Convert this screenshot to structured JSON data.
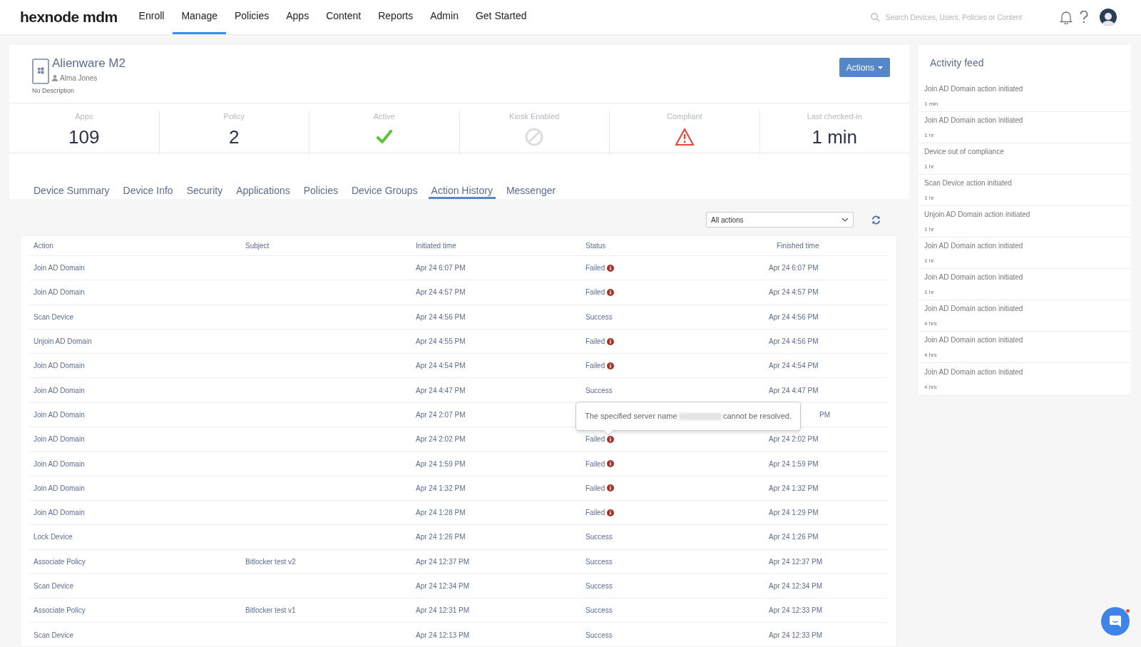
{
  "header": {
    "logo": "hexnode mdm",
    "nav": [
      {
        "label": "Enroll",
        "selected": false
      },
      {
        "label": "Manage",
        "selected": true
      },
      {
        "label": "Policies",
        "selected": false
      },
      {
        "label": "Apps",
        "selected": false
      },
      {
        "label": "Content",
        "selected": false
      },
      {
        "label": "Reports",
        "selected": false
      },
      {
        "label": "Admin",
        "selected": false
      },
      {
        "label": "Get Started",
        "selected": false
      }
    ],
    "search": {
      "placeholder": "Search Devices, Users, Policies or Content"
    }
  },
  "device": {
    "name": "Alienware M2",
    "user": "Alma Jones",
    "description": "No Description",
    "actions_button": "Actions"
  },
  "stats": [
    {
      "label": "Apps",
      "kind": "text",
      "value": "109"
    },
    {
      "label": "Policy",
      "kind": "text",
      "value": "2"
    },
    {
      "label": "Active",
      "kind": "check"
    },
    {
      "label": "Kiosk Enabled",
      "kind": "disabled"
    },
    {
      "label": "Compliant",
      "kind": "warning"
    },
    {
      "label": "Last checked-in",
      "kind": "text",
      "value": "1 min"
    }
  ],
  "tabs": [
    {
      "label": "Device Summary",
      "selected": false
    },
    {
      "label": "Device Info",
      "selected": false
    },
    {
      "label": "Security",
      "selected": false
    },
    {
      "label": "Applications",
      "selected": false
    },
    {
      "label": "Policies",
      "selected": false
    },
    {
      "label": "Device Groups",
      "selected": false
    },
    {
      "label": "Action History",
      "selected": true
    },
    {
      "label": "Messenger",
      "selected": false
    }
  ],
  "filter": {
    "value": "All actions"
  },
  "table": {
    "columns": [
      "Action",
      "Subject",
      "Initiated time",
      "Status",
      "Finished time"
    ],
    "rows": [
      {
        "action": "Join AD Domain",
        "initiated": "Apr 24 6:07 PM",
        "status": "Failed",
        "kind": "failed",
        "finished": "Apr 24 6:07 PM"
      },
      {
        "action": "Join AD Domain",
        "initiated": "Apr 24 4:57 PM",
        "status": "Failed",
        "kind": "failed",
        "finished": "Apr 24 4:57 PM"
      },
      {
        "action": "Scan Device",
        "initiated": "Apr 24 4:56 PM",
        "status": "Success",
        "kind": "success",
        "finished": "Apr 24 4:56 PM"
      },
      {
        "action": "Unjoin AD Domain",
        "initiated": "Apr 24 4:55 PM",
        "status": "Failed",
        "kind": "failed",
        "finished": "Apr 24 4:56 PM"
      },
      {
        "action": "Join AD Domain",
        "initiated": "Apr 24 4:54 PM",
        "status": "Failed",
        "kind": "failed",
        "finished": "Apr 24 4:54 PM"
      },
      {
        "action": "Join AD Domain",
        "initiated": "Apr 24 4:47 PM",
        "status": "Success",
        "kind": "success",
        "finished": "Apr 24 4:47 PM"
      },
      {
        "action": "Join AD Domain",
        "initiated": "Apr 24 2:07 PM",
        "finished": "PM"
      },
      {
        "action": "Join AD Domain",
        "initiated": "Apr 24 2:02 PM",
        "status": "Failed",
        "kind": "failed",
        "finished": "Apr 24 2:02 PM",
        "tooltip": {
          "before": "The specified server name",
          "after": "cannot be resolved."
        }
      },
      {
        "action": "Join AD Domain",
        "initiated": "Apr 24 1:59 PM",
        "status": "Failed",
        "kind": "failed",
        "finished": "Apr 24 1:59 PM"
      },
      {
        "action": "Join AD Domain",
        "initiated": "Apr 24 1:32 PM",
        "status": "Failed",
        "kind": "failed",
        "finished": "Apr 24 1:32 PM"
      },
      {
        "action": "Join AD Domain",
        "initiated": "Apr 24 1:28 PM",
        "status": "Failed",
        "kind": "failed",
        "finished": "Apr 24 1:29 PM"
      },
      {
        "action": "Lock Device",
        "initiated": "Apr 24 1:26 PM",
        "status": "Success",
        "kind": "success",
        "finished": "Apr 24 1:26 PM"
      },
      {
        "action": "Associate Policy",
        "subject": "Bitlocker test v2",
        "initiated": "Apr 24 12:37 PM",
        "status": "Success",
        "kind": "success",
        "finished": "Apr 24 12:37 PM"
      },
      {
        "action": "Scan Device",
        "initiated": "Apr 24 12:34 PM",
        "status": "Success",
        "kind": "success",
        "finished": "Apr 24 12:34 PM"
      },
      {
        "action": "Associate Policy",
        "subject": "Bitlocker test v1",
        "initiated": "Apr 24 12:31 PM",
        "status": "Success",
        "kind": "success",
        "finished": "Apr 24 12:33 PM"
      },
      {
        "action": "Scan Device",
        "initiated": "Apr 24 12:13 PM",
        "status": "Success",
        "kind": "success",
        "finished": "Apr 24 12:33 PM"
      }
    ]
  },
  "activity_feed": {
    "title": "Activity feed",
    "items": [
      {
        "text": "Join AD Domain action initiated",
        "time": "1 min"
      },
      {
        "text": "Join AD Domain action initiated",
        "time": "1 hr"
      },
      {
        "text": "Device out of compliance",
        "time": "1 hr"
      },
      {
        "text": "Scan Device action initiated",
        "time": "1 hr"
      },
      {
        "text": "Unjoin AD Domain action initiated",
        "time": "1 hr"
      },
      {
        "text": "Join AD Domain action initiated",
        "time": "1 hr"
      },
      {
        "text": "Join AD Domain action initiated",
        "time": "1 hr"
      },
      {
        "text": "Join AD Domain action initiated",
        "time": "4 hrs"
      },
      {
        "text": "Join AD Domain action initiated",
        "time": "4 hrs"
      },
      {
        "text": "Join AD Domain action initiated",
        "time": "4 hrs"
      }
    ]
  },
  "chat": {
    "unread": true
  }
}
